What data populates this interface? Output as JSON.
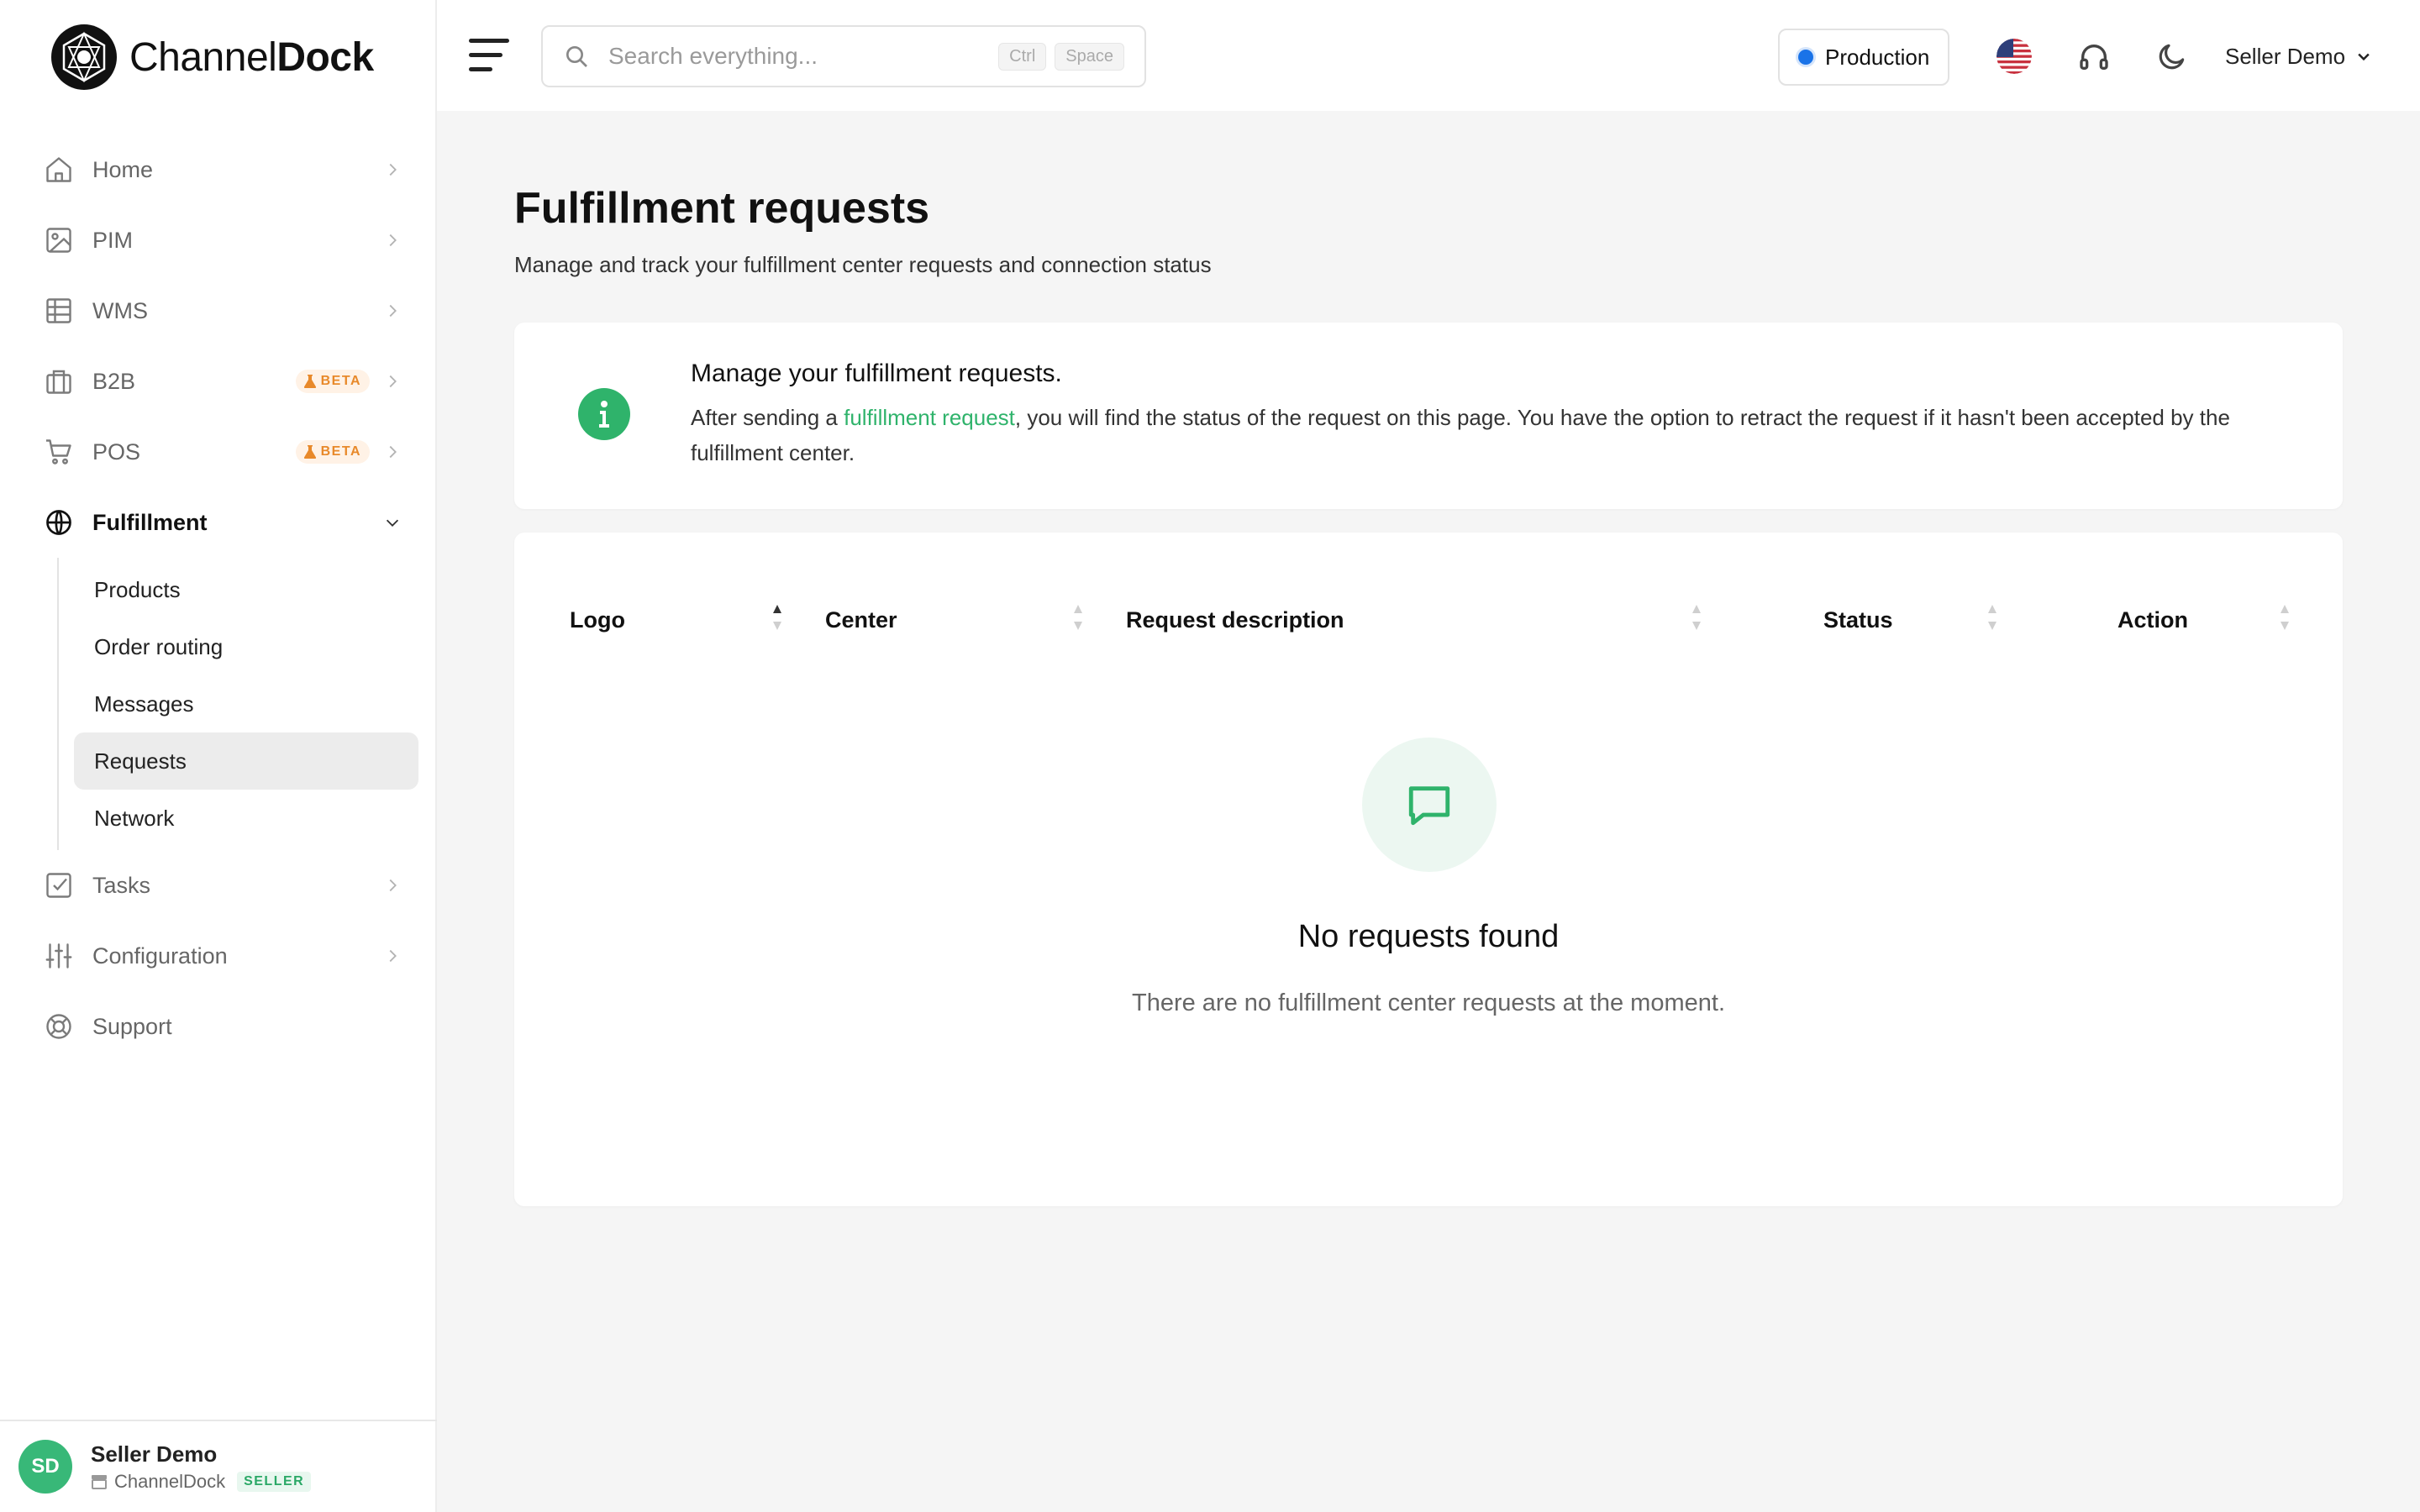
{
  "brand": {
    "name_light": "Channel",
    "name_bold": "Dock"
  },
  "search": {
    "placeholder": "Search everything...",
    "shortcut_1": "Ctrl",
    "shortcut_2": "Space"
  },
  "topbar": {
    "environment": "Production",
    "user": "Seller Demo"
  },
  "sidebar": {
    "items": [
      {
        "label": "Home",
        "icon": "home-icon"
      },
      {
        "label": "PIM",
        "icon": "image-icon"
      },
      {
        "label": "WMS",
        "icon": "table-icon"
      },
      {
        "label": "B2B",
        "icon": "briefcase-icon",
        "badge": "BETA"
      },
      {
        "label": "POS",
        "icon": "cart-icon",
        "badge": "BETA"
      },
      {
        "label": "Fulfillment",
        "icon": "globe-icon",
        "expanded": true
      }
    ],
    "fulfillment_sub": [
      {
        "label": "Products"
      },
      {
        "label": "Order routing"
      },
      {
        "label": "Messages"
      },
      {
        "label": "Requests",
        "active": true
      },
      {
        "label": "Network"
      }
    ],
    "items_after": [
      {
        "label": "Tasks",
        "icon": "checkbox-icon"
      },
      {
        "label": "Configuration",
        "icon": "sliders-icon"
      },
      {
        "label": "Support",
        "icon": "lifebuoy-icon"
      }
    ],
    "user": {
      "initials": "SD",
      "name": "Seller Demo",
      "org": "ChannelDock",
      "role": "SELLER"
    }
  },
  "page": {
    "title": "Fulfillment requests",
    "subtitle": "Manage and track your fulfillment center requests and connection status"
  },
  "info": {
    "title": "Manage your fulfillment requests.",
    "text_before": "After sending a ",
    "link": "fulfillment request",
    "text_after": ", you will find the status of the request on this page. You have the option to retract the request if it hasn't been accepted by the fulfillment center."
  },
  "table": {
    "columns": [
      "Logo",
      "Center",
      "Request description",
      "Status",
      "Action"
    ],
    "empty_title": "No requests found",
    "empty_text": "There are no fulfillment center requests at the moment."
  },
  "colors": {
    "accent": "#2fb36b",
    "env_dot": "#1a73e8",
    "beta": "#e8892a"
  }
}
